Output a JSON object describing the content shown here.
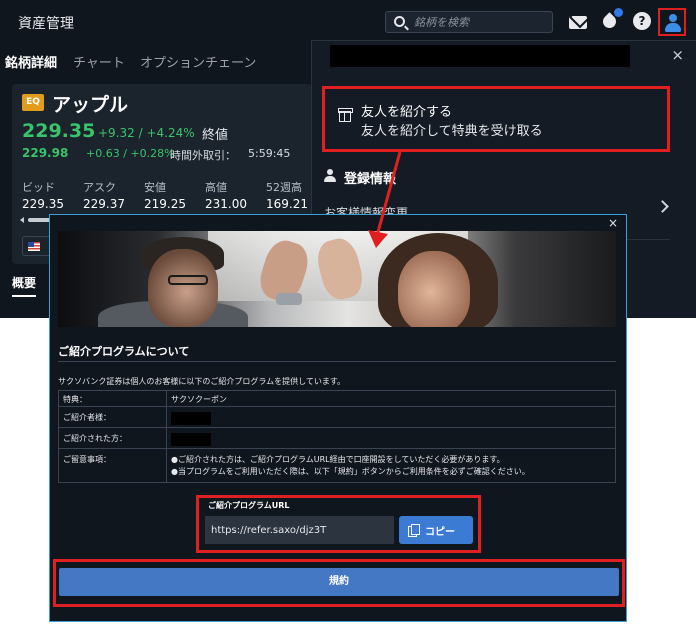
{
  "app": {
    "title": "資産管理",
    "search_placeholder": "銘柄を検索",
    "tabs": [
      "銘柄詳細",
      "チャート",
      "オプションチェーン"
    ]
  },
  "instrument": {
    "badge": "EQ",
    "name": "アップル",
    "last_price": "229.35",
    "change": "+9.32 / +4.24%",
    "close_label": "終値",
    "ah_price": "229.98",
    "ah_change": "+0.63 / +0.28%",
    "ah_label": "時間外取引：",
    "ah_time": "5:59:45",
    "quotes": [
      {
        "label": "ビッド",
        "value": "229.35"
      },
      {
        "label": "アスク",
        "value": "229.37"
      },
      {
        "label": "安値",
        "value": "219.25"
      },
      {
        "label": "高値",
        "value": "231.00"
      },
      {
        "label": "52週高",
        "value": "169.21"
      }
    ],
    "overview_tab": "概要"
  },
  "menu": {
    "close": "×",
    "referral_title": "友人を紹介する",
    "referral_subtitle": "友人を紹介して特典を受け取る",
    "registration_heading": "登録情報",
    "customer_info_row": "お客様情報変更"
  },
  "modal": {
    "close": "×",
    "heading": "ご紹介プログラムについて",
    "intro": "サクソバンク証券は個人のお客様に以下のご紹介プログラムを提供しています。",
    "rows": {
      "benefit_label": "特典：",
      "benefit_value": "サクソクーポン",
      "referrer_label": "ご紹介者様：",
      "referred_label": "ご紹介された方：",
      "notes_label": "ご留意事項：",
      "note1": "●ご紹介された方は、ご紹介プログラムURL経由で口座開設をしていただく必要があります。",
      "note2": "●当プログラムをご利用いただく際は、以下「規約」ボタンからご利用条件を必ずご確認ください。"
    },
    "url_label": "ご紹介プログラムURL",
    "url_value": "https://refer.saxo/djz3T",
    "copy_label": "コピー",
    "terms_label": "規約"
  }
}
